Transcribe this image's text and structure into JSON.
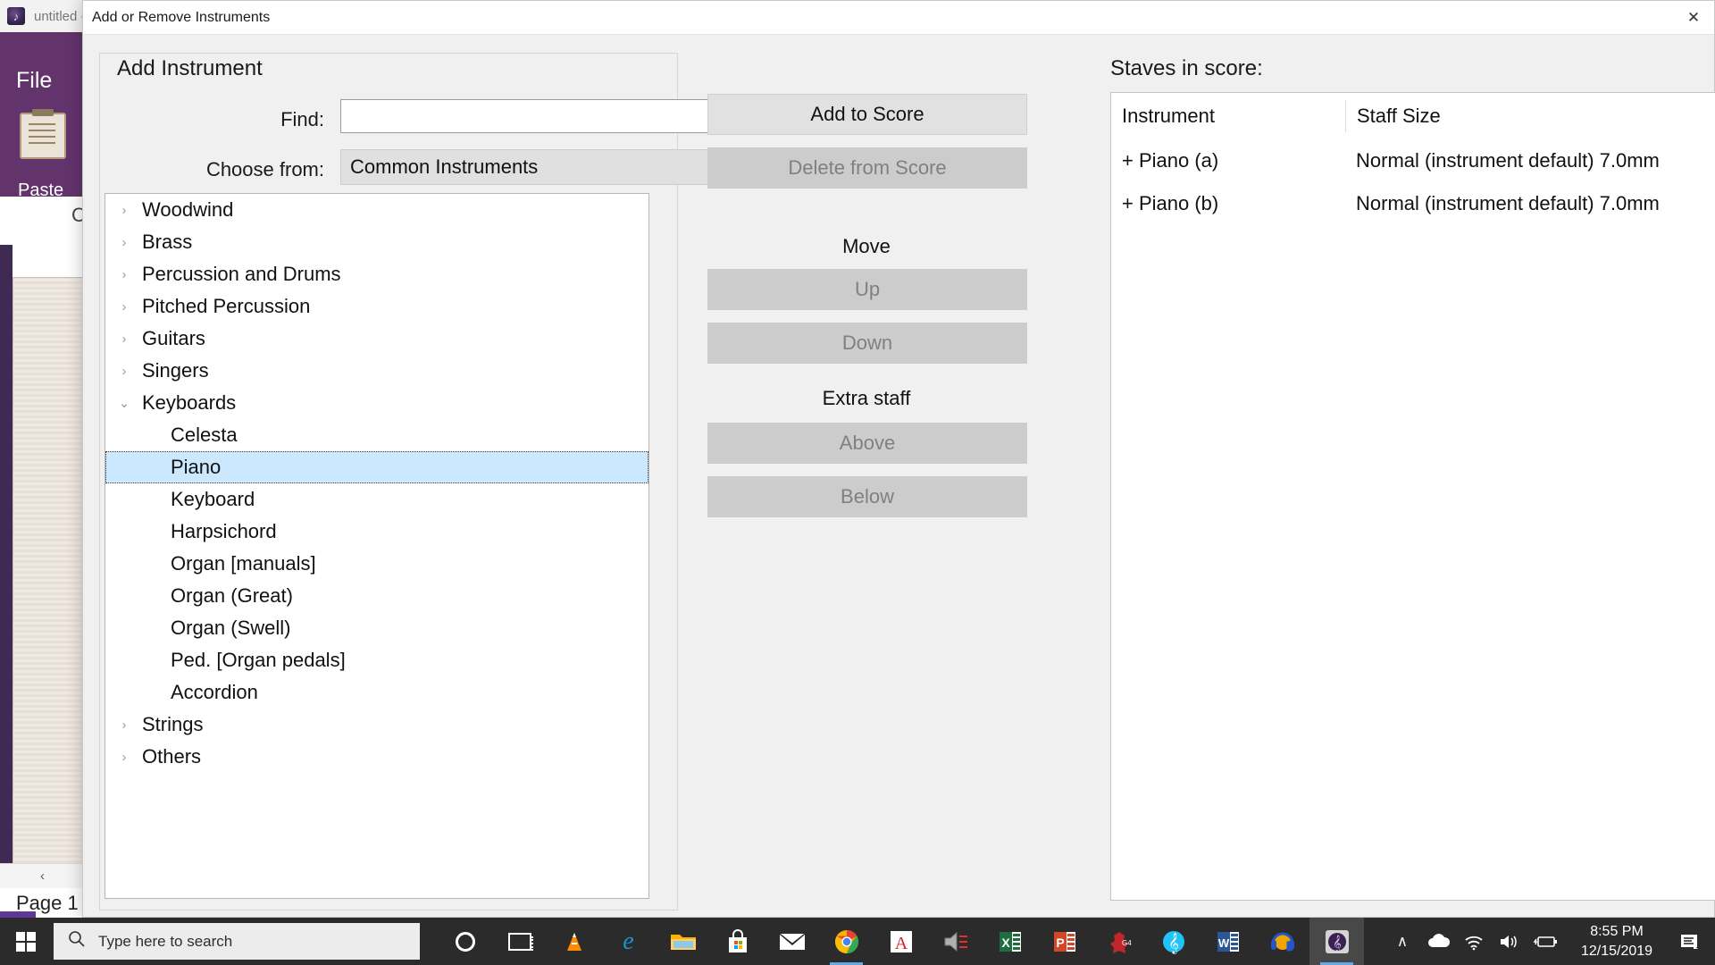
{
  "app": {
    "window_title": "untitled -",
    "ribbon_file_tab": "File",
    "paste_label": "Paste",
    "page_label": "Page 1",
    "c_glyph": "C",
    "help_glyph": "?",
    "minimize_glyph": "—",
    "maximize_glyph": "❐",
    "close_glyph": "✕",
    "scroll_left_glyph": "‹",
    "scroll_up_glyph": "∧",
    "scroll_down_glyph": "∨",
    "plus_glyph": "+",
    "panel_glyph": "🛒"
  },
  "dialog": {
    "title": "Add or Remove Instruments",
    "close_glyph": "✕",
    "group_title": "Add Instrument",
    "find": {
      "label": "Find:",
      "value": "",
      "placeholder": ""
    },
    "choose_from": {
      "label": "Choose from:",
      "selected": "Common Instruments",
      "chevron": "⌄",
      "options": [
        "Common Instruments"
      ]
    },
    "tree": [
      {
        "label": "Woodwind",
        "type": "group",
        "expanded": false,
        "twisty": "›"
      },
      {
        "label": "Brass",
        "type": "group",
        "expanded": false,
        "twisty": "›"
      },
      {
        "label": "Percussion and Drums",
        "type": "group",
        "expanded": false,
        "twisty": "›"
      },
      {
        "label": "Pitched Percussion",
        "type": "group",
        "expanded": false,
        "twisty": "›"
      },
      {
        "label": "Guitars",
        "type": "group",
        "expanded": false,
        "twisty": "›"
      },
      {
        "label": "Singers",
        "type": "group",
        "expanded": false,
        "twisty": "›"
      },
      {
        "label": "Keyboards",
        "type": "group",
        "expanded": true,
        "twisty": "⌄"
      },
      {
        "label": "Celesta",
        "type": "leaf",
        "selected": false
      },
      {
        "label": "Piano",
        "type": "leaf",
        "selected": true
      },
      {
        "label": "Keyboard",
        "type": "leaf",
        "selected": false
      },
      {
        "label": "Harpsichord",
        "type": "leaf",
        "selected": false
      },
      {
        "label": "Organ [manuals]",
        "type": "leaf",
        "selected": false
      },
      {
        "label": "Organ (Great)",
        "type": "leaf",
        "selected": false
      },
      {
        "label": "Organ (Swell)",
        "type": "leaf",
        "selected": false
      },
      {
        "label": "Ped. [Organ pedals]",
        "type": "leaf",
        "selected": false
      },
      {
        "label": "Accordion",
        "type": "leaf",
        "selected": false
      },
      {
        "label": "Strings",
        "type": "group",
        "expanded": false,
        "twisty": "›"
      },
      {
        "label": "Others",
        "type": "group",
        "expanded": false,
        "twisty": "›"
      }
    ],
    "actions": {
      "add_to_score": {
        "label": "Add to Score",
        "enabled": true
      },
      "delete_from_score": {
        "label": "Delete from Score",
        "enabled": false
      },
      "move_heading": "Move",
      "move_up": {
        "label": "Up",
        "enabled": false
      },
      "move_down": {
        "label": "Down",
        "enabled": false
      },
      "extra_staff_heading": "Extra staff",
      "extra_above": {
        "label": "Above",
        "enabled": false
      },
      "extra_below": {
        "label": "Below",
        "enabled": false
      }
    },
    "staves": {
      "label": "Staves in score:",
      "columns": [
        "Instrument",
        "Staff Size"
      ],
      "rows": [
        {
          "instrument": "+ Piano (a)",
          "staff_size": "Normal (instrument default) 7.0mm"
        },
        {
          "instrument": "+ Piano (b)",
          "staff_size": "Normal (instrument default) 7.0mm"
        }
      ]
    }
  },
  "taskbar": {
    "search_placeholder": "Type here to search",
    "search_icon": "🔍",
    "items": [
      {
        "name": "cortana",
        "glyph": ""
      },
      {
        "name": "task-view",
        "glyph": ""
      },
      {
        "name": "vlc-media-player",
        "glyph": ""
      },
      {
        "name": "microsoft-edge",
        "glyph": "e"
      },
      {
        "name": "file-explorer",
        "glyph": ""
      },
      {
        "name": "microsoft-store",
        "glyph": ""
      },
      {
        "name": "mail",
        "glyph": "✉"
      },
      {
        "name": "google-chrome",
        "glyph": ""
      },
      {
        "name": "adobe-acrobat-reader",
        "glyph": "A"
      },
      {
        "name": "audio-mixer",
        "glyph": ""
      },
      {
        "name": "microsoft-excel",
        "glyph": "X"
      },
      {
        "name": "microsoft-powerpoint",
        "glyph": "P"
      },
      {
        "name": "guitar-pro",
        "glyph": "G4"
      },
      {
        "name": "musescore",
        "glyph": "𝄞"
      },
      {
        "name": "microsoft-word",
        "glyph": "W"
      },
      {
        "name": "audacity",
        "glyph": ""
      },
      {
        "name": "sibelius",
        "glyph": "𝄞"
      }
    ],
    "tray": {
      "show_hidden_icons": "∧",
      "onedrive": "☁",
      "network": "ʇ",
      "volume": "🔊",
      "battery": "🔋",
      "time": "8:55 PM",
      "date": "12/15/2019",
      "action_center": "💬"
    }
  }
}
